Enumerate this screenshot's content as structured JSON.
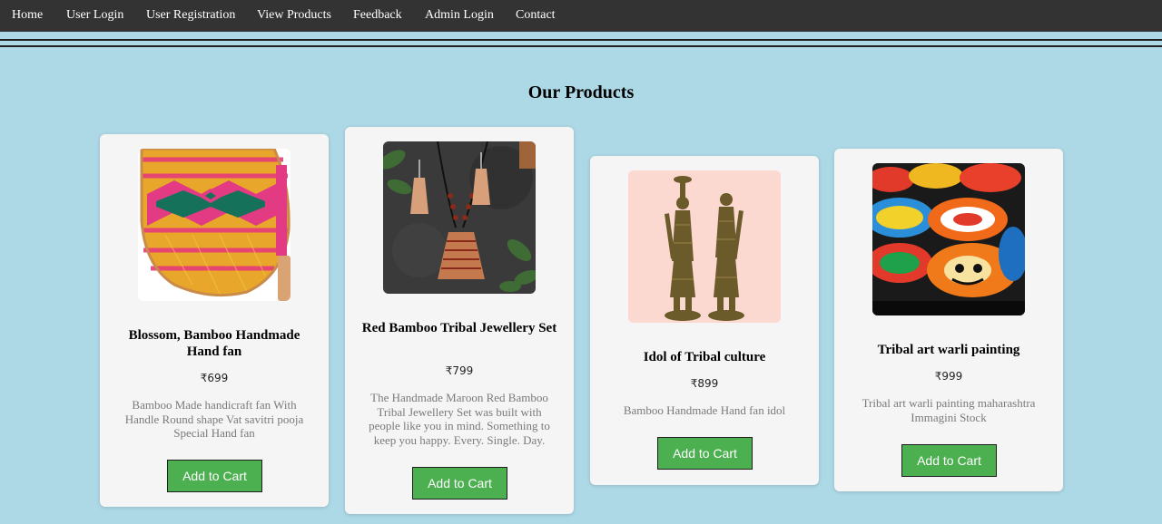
{
  "nav": {
    "items": [
      "Home",
      "User Login",
      "User Registration",
      "View Products",
      "Feedback",
      "Admin Login",
      "Contact"
    ]
  },
  "page": {
    "title": "Our Products"
  },
  "products": [
    {
      "name": "Blossom, Bamboo Handmade Hand fan",
      "price": "₹699",
      "description": "Bamboo Made handicraft fan With Handle Round shape Vat savitri pooja Special Hand fan",
      "button": "Add to Cart",
      "image_icon": "woven-hand-fan-image"
    },
    {
      "name": "Red Bamboo Tribal Jewellery Set",
      "price": "₹799",
      "description": "The Handmade Maroon Red Bamboo Tribal Jewellery Set was built with people like you in mind. Something to keep you happy. Every. Single. Day.",
      "button": "Add to Cart",
      "image_icon": "necklace-earrings-image"
    },
    {
      "name": "Idol of Tribal culture",
      "price": "₹899",
      "description": "Bamboo Handmade Hand fan idol",
      "button": "Add to Cart",
      "image_icon": "brass-idol-image"
    },
    {
      "name": "Tribal art warli painting",
      "price": "₹999",
      "description": "Tribal art warli painting maharashtra Immagini Stock",
      "button": "Add to Cart",
      "image_icon": "painted-boxes-image"
    }
  ],
  "colors": {
    "background": "#add8e6",
    "navbar": "#333333",
    "card": "#f5f5f5",
    "button": "#4caf50"
  }
}
